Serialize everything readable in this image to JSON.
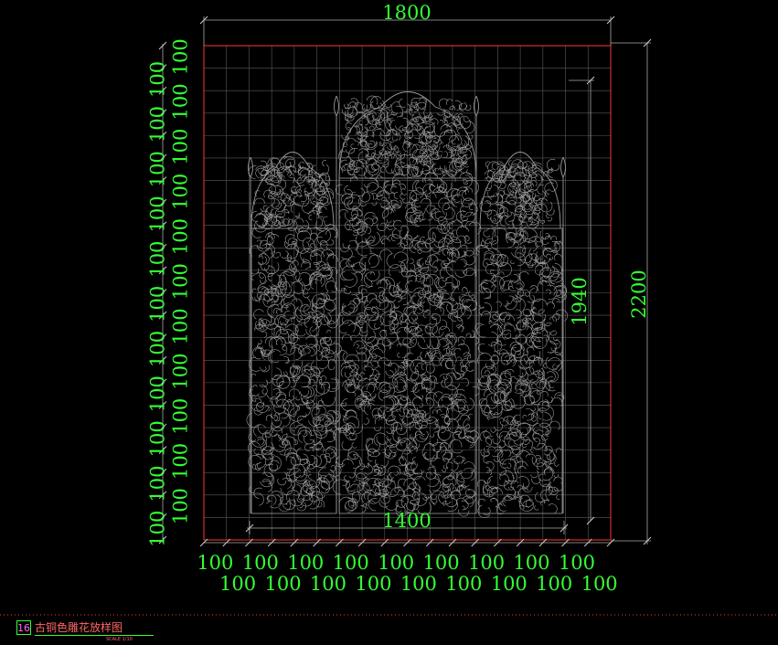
{
  "drawing": {
    "overall_width_label": "1800",
    "overall_height_label": "2200",
    "inner_height_label": "1940",
    "inner_width_label": "1400",
    "grid_label": "100",
    "grid_columns": 18,
    "grid_rows": 22
  },
  "title_block": {
    "number": "16",
    "title": "古铜色雕花放样图",
    "scale": "SCALE 1/10"
  },
  "colors": {
    "background": "#000000",
    "dimension_text": "#33ff33",
    "frame_line": "#ff3333",
    "grid_line": "#5a5a5a",
    "ornament_line": "#9a9a9a",
    "title_text": "#ff6666"
  }
}
